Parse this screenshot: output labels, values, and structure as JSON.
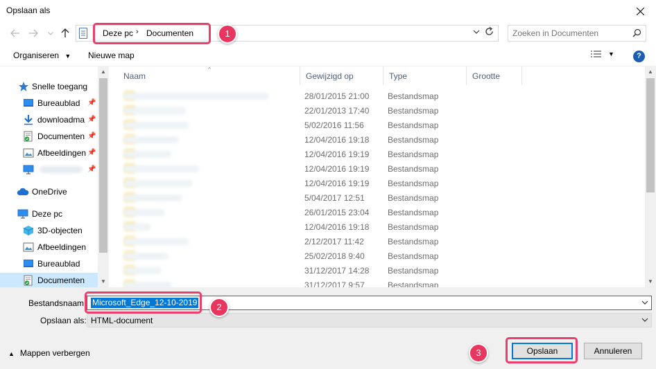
{
  "window": {
    "title": "Opslaan als"
  },
  "address": {
    "crumbs": [
      "Deze pc",
      "Documenten"
    ]
  },
  "search": {
    "placeholder": "Zoeken in Documenten"
  },
  "toolbar": {
    "organize_label": "Organiseren",
    "new_folder_label": "Nieuwe map"
  },
  "sidebar": {
    "items": [
      {
        "label": "Snelle toegang",
        "icon": "star-icon"
      },
      {
        "label": "Bureaublad",
        "icon": "desktop-icon",
        "pinned": true
      },
      {
        "label": "downloadma",
        "icon": "download-icon",
        "pinned": true
      },
      {
        "label": "Documenten",
        "icon": "documents-icon",
        "pinned": true
      },
      {
        "label": "Afbeeldingen",
        "icon": "pictures-icon",
        "pinned": true
      },
      {
        "label": "",
        "icon": "monitor-icon",
        "pinned": true
      },
      {
        "label": "OneDrive",
        "icon": "cloud-icon"
      },
      {
        "label": "Deze pc",
        "icon": "computer-icon"
      },
      {
        "label": "3D-objecten",
        "icon": "cube-icon"
      },
      {
        "label": "Afbeeldingen",
        "icon": "pictures-icon"
      },
      {
        "label": "Bureaublad",
        "icon": "desktop-icon"
      },
      {
        "label": "Documenten",
        "icon": "documents-icon",
        "selected": true
      }
    ]
  },
  "columns": {
    "name": "Naam",
    "modified": "Gewijzigd op",
    "type": "Type",
    "size": "Grootte"
  },
  "files": [
    {
      "date": "28/01/2015 21:00",
      "type": "Bestandsmap"
    },
    {
      "date": "22/01/2013 17:40",
      "type": "Bestandsmap"
    },
    {
      "date": "5/02/2016 11:56",
      "type": "Bestandsmap"
    },
    {
      "date": "12/04/2016 19:18",
      "type": "Bestandsmap"
    },
    {
      "date": "12/04/2016 19:19",
      "type": "Bestandsmap"
    },
    {
      "date": "12/04/2016 19:19",
      "type": "Bestandsmap"
    },
    {
      "date": "12/04/2016 19:19",
      "type": "Bestandsmap"
    },
    {
      "date": "5/04/2017 12:51",
      "type": "Bestandsmap"
    },
    {
      "date": "26/01/2015 23:04",
      "type": "Bestandsmap"
    },
    {
      "date": "12/04/2016 19:18",
      "type": "Bestandsmap"
    },
    {
      "date": "2/12/2017 11:42",
      "type": "Bestandsmap"
    },
    {
      "date": "25/02/2018 9:40",
      "type": "Bestandsmap"
    },
    {
      "date": "31/12/2017 14:28",
      "type": "Bestandsmap"
    },
    {
      "date": "31/12/2017 9:57",
      "type": "Bestandsmap"
    }
  ],
  "form": {
    "filename_label": "Bestandsnaam:",
    "filename_value": "Microsoft_Edge_12-10-2019",
    "savetype_label": "Opslaan als:",
    "savetype_value": "HTML-document"
  },
  "footer": {
    "hide_folders_label": "Mappen verbergen",
    "save_label": "Opslaan",
    "cancel_label": "Annuleren"
  },
  "callouts": [
    "1",
    "2",
    "3"
  ],
  "colors": {
    "accent": "#0078d7",
    "highlight": "#ea3e6c",
    "badge": "#e8365f"
  }
}
